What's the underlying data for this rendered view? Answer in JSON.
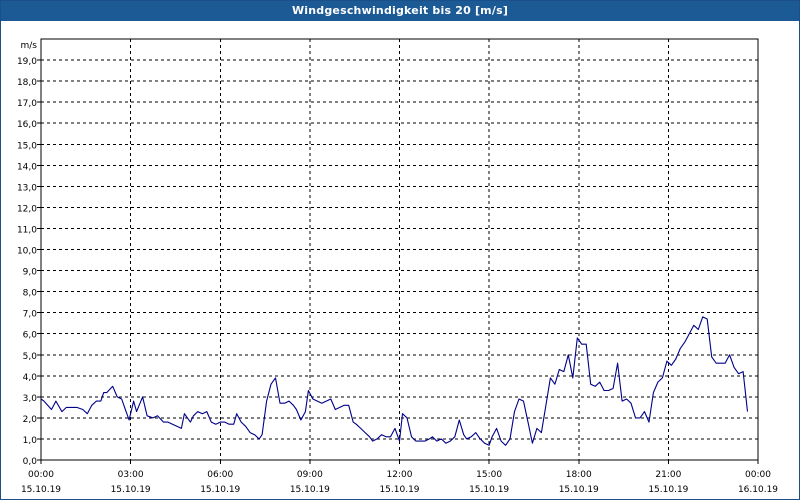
{
  "window": {
    "title": "Windgeschwindigkeit bis 20 [m/s]"
  },
  "colors": {
    "titlebar": "#1c5a96",
    "series": "#00008b",
    "grid": "#000000"
  },
  "chart_data": {
    "type": "line",
    "title": "Windgeschwindigkeit bis 20 [m/s]",
    "ylabel": "m/s",
    "xlabel": "",
    "ylim": [
      0,
      20
    ],
    "xlim_hours": [
      0,
      24
    ],
    "grid": true,
    "y_ticks": [
      "0,0",
      "1,0",
      "2,0",
      "3,0",
      "4,0",
      "5,0",
      "6,0",
      "7,0",
      "8,0",
      "9,0",
      "10,0",
      "11,0",
      "12,0",
      "13,0",
      "14,0",
      "15,0",
      "16,0",
      "17,0",
      "18,0",
      "19,0"
    ],
    "x_ticks": [
      {
        "time": "00:00",
        "date": "15.10.19"
      },
      {
        "time": "03:00",
        "date": "15.10.19"
      },
      {
        "time": "06:00",
        "date": "15.10.19"
      },
      {
        "time": "09:00",
        "date": "15.10.19"
      },
      {
        "time": "12:00",
        "date": "15.10.19"
      },
      {
        "time": "15:00",
        "date": "15.10.19"
      },
      {
        "time": "18:00",
        "date": "15.10.19"
      },
      {
        "time": "21:00",
        "date": "15.10.19"
      },
      {
        "time": "00:00",
        "date": "16.10.19"
      }
    ],
    "series": [
      {
        "x_hours": [
          0.0,
          0.1,
          0.35,
          0.5,
          0.7,
          0.85,
          1.0,
          1.2,
          1.4,
          1.55,
          1.7,
          1.85,
          2.0,
          2.1,
          2.2,
          2.4,
          2.55,
          2.7,
          2.8,
          2.95,
          3.1,
          3.2,
          3.4,
          3.55,
          3.75,
          3.9,
          4.1,
          4.25,
          4.4,
          4.55,
          4.7,
          4.8,
          5.0,
          5.1,
          5.25,
          5.4,
          5.55,
          5.7,
          5.85,
          6.0,
          6.15,
          6.3,
          6.45,
          6.55,
          6.7,
          6.85,
          7.0,
          7.15,
          7.3,
          7.4,
          7.55,
          7.7,
          7.85,
          8.0,
          8.15,
          8.3,
          8.45,
          8.55,
          8.7,
          8.85,
          8.95,
          9.1,
          9.25,
          9.4,
          9.55,
          9.7,
          9.85,
          10.0,
          10.15,
          10.3,
          10.45,
          10.55,
          10.7,
          10.85,
          11.0,
          11.1,
          11.25,
          11.4,
          11.55,
          11.7,
          11.85,
          12.0,
          12.1,
          12.25,
          12.4,
          12.55,
          12.7,
          12.85,
          13.0,
          13.1,
          13.25,
          13.4,
          13.55,
          13.7,
          13.85,
          14.0,
          14.15,
          14.25,
          14.4,
          14.55,
          14.7,
          14.85,
          15.0,
          15.1,
          15.25,
          15.4,
          15.55,
          15.7,
          15.85,
          16.0,
          16.15,
          16.3,
          16.45,
          16.6,
          16.75,
          16.9,
          17.05,
          17.2,
          17.35,
          17.5,
          17.65,
          17.8,
          17.95,
          18.1,
          18.25,
          18.4,
          18.55,
          18.7,
          18.85,
          19.0,
          19.15,
          19.3,
          19.45,
          19.6,
          19.75,
          19.9,
          20.05,
          20.2,
          20.35,
          20.5,
          20.65,
          20.8,
          20.95,
          21.1,
          21.25,
          21.4,
          21.55,
          21.7,
          21.85,
          22.0,
          22.15,
          22.3,
          22.45,
          22.6,
          22.75,
          22.9,
          23.05,
          23.2,
          23.35,
          23.5,
          23.65,
          23.8,
          23.9
        ],
        "values": [
          2.9,
          2.8,
          2.4,
          2.8,
          2.3,
          2.5,
          2.5,
          2.5,
          2.4,
          2.2,
          2.6,
          2.8,
          2.8,
          3.2,
          3.2,
          3.5,
          3.0,
          2.9,
          2.5,
          1.9,
          2.8,
          2.3,
          3.0,
          2.1,
          2.0,
          2.1,
          1.8,
          1.8,
          1.7,
          1.6,
          1.5,
          2.2,
          1.8,
          2.1,
          2.3,
          2.2,
          2.3,
          1.8,
          1.7,
          1.8,
          1.8,
          1.7,
          1.7,
          2.2,
          1.8,
          1.6,
          1.3,
          1.2,
          1.0,
          1.2,
          2.8,
          3.6,
          3.9,
          2.7,
          2.7,
          2.8,
          2.6,
          2.4,
          1.9,
          2.3,
          3.3,
          2.9,
          2.8,
          2.7,
          2.8,
          2.9,
          2.4,
          2.5,
          2.6,
          2.6,
          1.8,
          1.7,
          1.5,
          1.3,
          1.1,
          0.9,
          1.0,
          1.2,
          1.1,
          1.1,
          1.5,
          0.9,
          2.2,
          2.0,
          1.1,
          0.9,
          0.9,
          0.9,
          1.0,
          1.1,
          0.9,
          1.0,
          0.8,
          0.9,
          1.1,
          1.9,
          1.2,
          1.0,
          1.1,
          1.3,
          1.0,
          0.8,
          0.7,
          1.1,
          1.5,
          0.9,
          0.7,
          1.0,
          2.3,
          2.9,
          2.8,
          1.8,
          0.8,
          1.5,
          1.3,
          2.6,
          3.9,
          3.6,
          4.3,
          4.2,
          5.0,
          3.9,
          5.8,
          5.5,
          5.5,
          3.6,
          3.5,
          3.7,
          3.3,
          3.3,
          3.4,
          4.6,
          2.8,
          2.9,
          2.7,
          2.0,
          2.0,
          2.3,
          1.8,
          3.2,
          3.7,
          3.9,
          4.7,
          4.5,
          4.8,
          5.3,
          5.6,
          6.0,
          6.4,
          6.2,
          6.8,
          6.7,
          4.9,
          4.6,
          4.6,
          4.6,
          5.0,
          4.4,
          4.1,
          4.2,
          2.3
        ]
      }
    ]
  }
}
